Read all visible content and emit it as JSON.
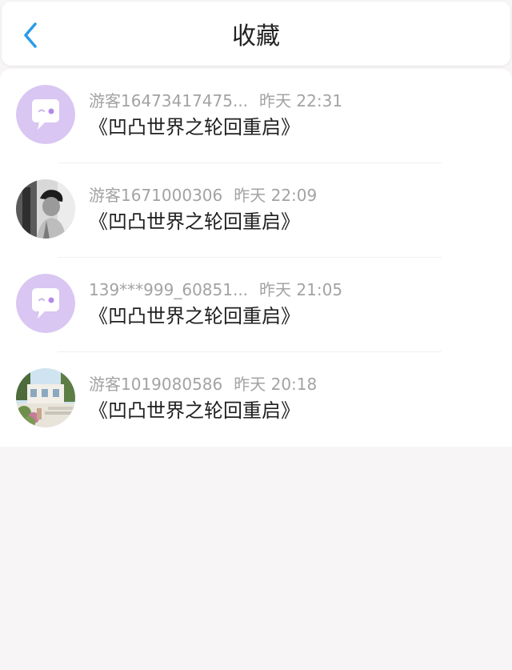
{
  "header": {
    "title": "收藏",
    "back_icon": "chevron-left-icon",
    "accent_color": "#2b9bea"
  },
  "favorites": [
    {
      "username": "游客16473417475...",
      "time": "昨天 22:31",
      "title": "《凹凸世界之轮回重启》",
      "avatar": "default-chat-bubble-avatar"
    },
    {
      "username": "游客1671000306",
      "time": "昨天 22:09",
      "title": "《凹凸世界之轮回重启》",
      "avatar": "photo-avatar-person"
    },
    {
      "username": "139***999_60851...",
      "time": "昨天 21:05",
      "title": "《凹凸世界之轮回重启》",
      "avatar": "default-chat-bubble-avatar"
    },
    {
      "username": "游客1019080586",
      "time": "昨天 20:18",
      "title": "《凹凸世界之轮回重启》",
      "avatar": "photo-avatar-garden"
    }
  ],
  "colors": {
    "page_background": "#f7f5f6",
    "card_background": "#ffffff",
    "default_avatar_background": "#d9c6f2",
    "meta_text": "#a3a3a3",
    "title_text": "#1f1f1f"
  }
}
